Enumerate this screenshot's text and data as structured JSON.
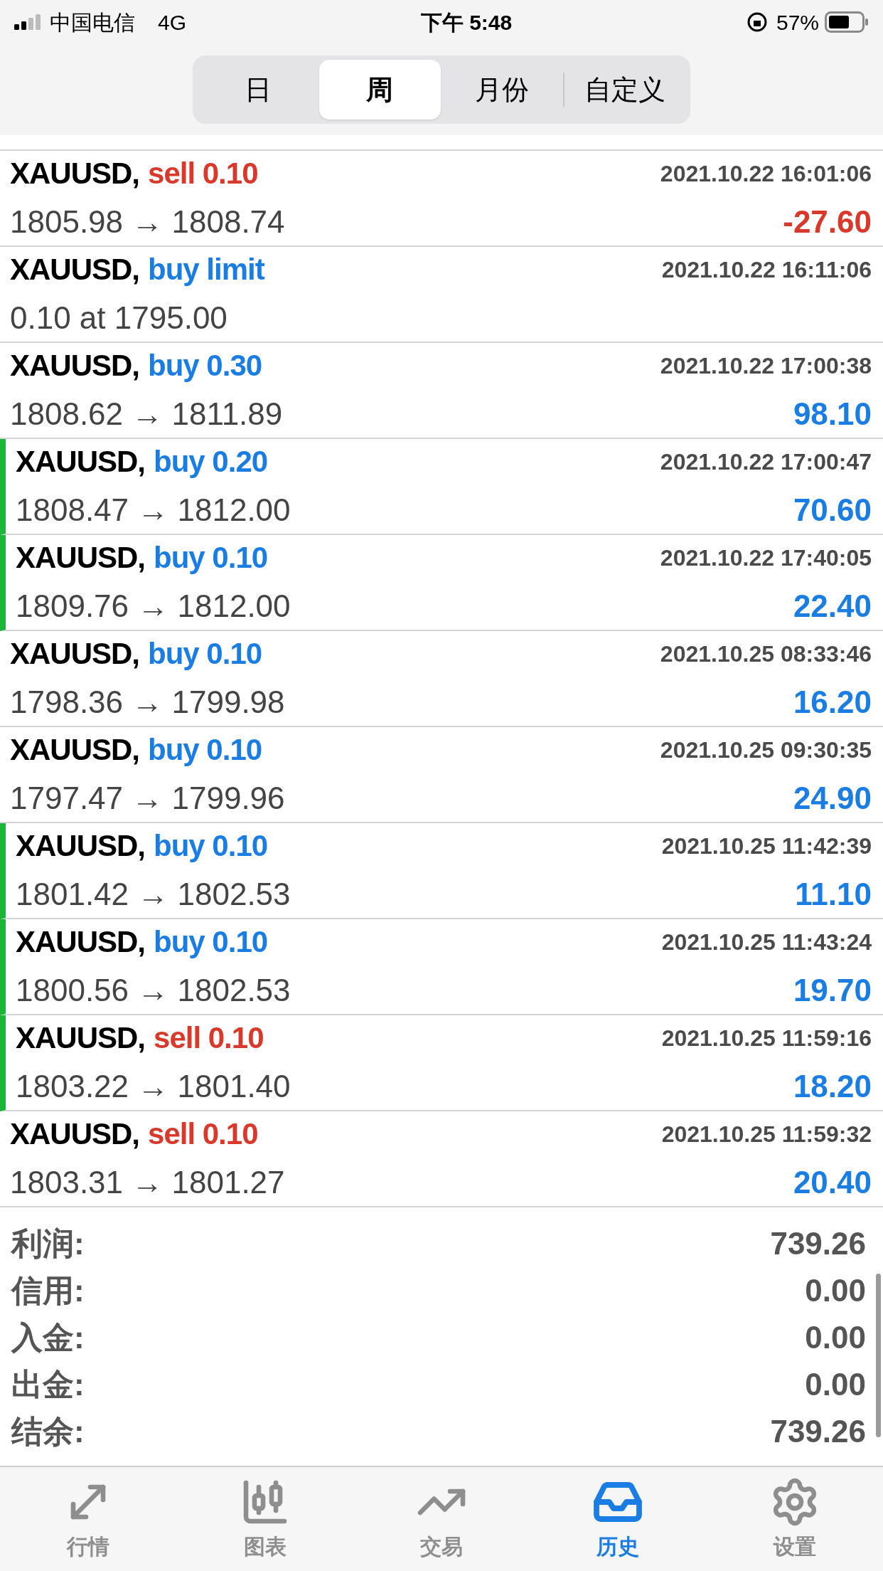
{
  "status_bar": {
    "carrier": "中国电信",
    "network": "4G",
    "time": "下午 5:48",
    "battery": "57%"
  },
  "period_tabs": [
    {
      "label": "日",
      "selected": false
    },
    {
      "label": "周",
      "selected": true
    },
    {
      "label": "月份",
      "selected": false
    },
    {
      "label": "自定义",
      "selected": false
    }
  ],
  "deals": [
    {
      "symbol": "XAUUSD,",
      "kind": "sell",
      "action": "sell 0.10",
      "time": "2021.10.22 16:01:06",
      "prices": "1805.98 → 1808.74",
      "profit": "-27.60",
      "loss": true,
      "marked": false
    },
    {
      "symbol": "XAUUSD,",
      "kind": "buy",
      "action": "buy limit",
      "time": "2021.10.22 16:11:06",
      "prices": "0.10 at 1795.00",
      "marked": false
    },
    {
      "symbol": "XAUUSD,",
      "kind": "buy",
      "action": "buy 0.30",
      "time": "2021.10.22 17:00:38",
      "prices": "1808.62 → 1811.89",
      "profit": "98.10",
      "loss": false,
      "marked": false
    },
    {
      "symbol": "XAUUSD,",
      "kind": "buy",
      "action": "buy 0.20",
      "time": "2021.10.22 17:00:47",
      "prices": "1808.47 → 1812.00",
      "profit": "70.60",
      "loss": false,
      "marked": true
    },
    {
      "symbol": "XAUUSD,",
      "kind": "buy",
      "action": "buy 0.10",
      "time": "2021.10.22 17:40:05",
      "prices": "1809.76 → 1812.00",
      "profit": "22.40",
      "loss": false,
      "marked": true
    },
    {
      "symbol": "XAUUSD,",
      "kind": "buy",
      "action": "buy 0.10",
      "time": "2021.10.25 08:33:46",
      "prices": "1798.36 → 1799.98",
      "profit": "16.20",
      "loss": false,
      "marked": false
    },
    {
      "symbol": "XAUUSD,",
      "kind": "buy",
      "action": "buy 0.10",
      "time": "2021.10.25 09:30:35",
      "prices": "1797.47 → 1799.96",
      "profit": "24.90",
      "loss": false,
      "marked": false
    },
    {
      "symbol": "XAUUSD,",
      "kind": "buy",
      "action": "buy 0.10",
      "time": "2021.10.25 11:42:39",
      "prices": "1801.42 → 1802.53",
      "profit": "11.10",
      "loss": false,
      "marked": true
    },
    {
      "symbol": "XAUUSD,",
      "kind": "buy",
      "action": "buy 0.10",
      "time": "2021.10.25 11:43:24",
      "prices": "1800.56 → 1802.53",
      "profit": "19.70",
      "loss": false,
      "marked": true
    },
    {
      "symbol": "XAUUSD,",
      "kind": "sell",
      "action": "sell 0.10",
      "time": "2021.10.25 11:59:16",
      "prices": "1803.22 → 1801.40",
      "profit": "18.20",
      "loss": false,
      "marked": true
    },
    {
      "symbol": "XAUUSD,",
      "kind": "sell",
      "action": "sell 0.10",
      "time": "2021.10.25 11:59:32",
      "prices": "1803.31 → 1801.27",
      "profit": "20.40",
      "loss": false,
      "marked": false
    }
  ],
  "summary": [
    {
      "label": "利润:",
      "value": "739.26"
    },
    {
      "label": "信用:",
      "value": "0.00"
    },
    {
      "label": "入金:",
      "value": "0.00"
    },
    {
      "label": "出金:",
      "value": "0.00"
    },
    {
      "label": "结余:",
      "value": "739.26"
    }
  ],
  "tab_bar": [
    {
      "label": "行情",
      "selected": false
    },
    {
      "label": "图表",
      "selected": false
    },
    {
      "label": "交易",
      "selected": false
    },
    {
      "label": "历史",
      "selected": true
    },
    {
      "label": "设置",
      "selected": false
    }
  ]
}
